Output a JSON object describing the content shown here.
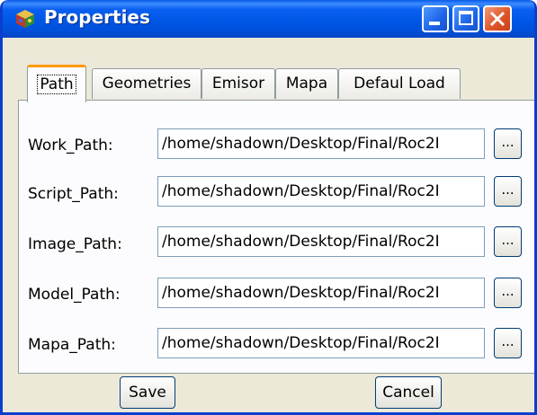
{
  "window": {
    "title": "Properties"
  },
  "tabs": [
    {
      "label": "Path",
      "active": true
    },
    {
      "label": "Geometries",
      "active": false
    },
    {
      "label": "Emisor",
      "active": false
    },
    {
      "label": "Mapa",
      "active": false
    },
    {
      "label": "Defaul Load",
      "active": false
    }
  ],
  "rows": [
    {
      "label": "Work_Path:",
      "value": "/home/shadown/Desktop/Final/Roc2I",
      "button": "..."
    },
    {
      "label": "Script_Path:",
      "value": "/home/shadown/Desktop/Final/Roc2I",
      "button": "..."
    },
    {
      "label": "Image_Path:",
      "value": "/home/shadown/Desktop/Final/Roc2I",
      "button": "..."
    },
    {
      "label": "Model_Path:",
      "value": "/home/shadown/Desktop/Final/Roc2I",
      "button": "..."
    },
    {
      "label": "Mapa_Path:",
      "value": "/home/shadown/Desktop/Final/Roc2I",
      "button": "..."
    }
  ],
  "buttons": {
    "save": "Save",
    "cancel": "Cancel"
  },
  "colors": {
    "title_bar": "#0057E6",
    "close": "#E05528",
    "active_tab_accent": "#FF9900",
    "dialog_bg": "#ECE9D8"
  }
}
